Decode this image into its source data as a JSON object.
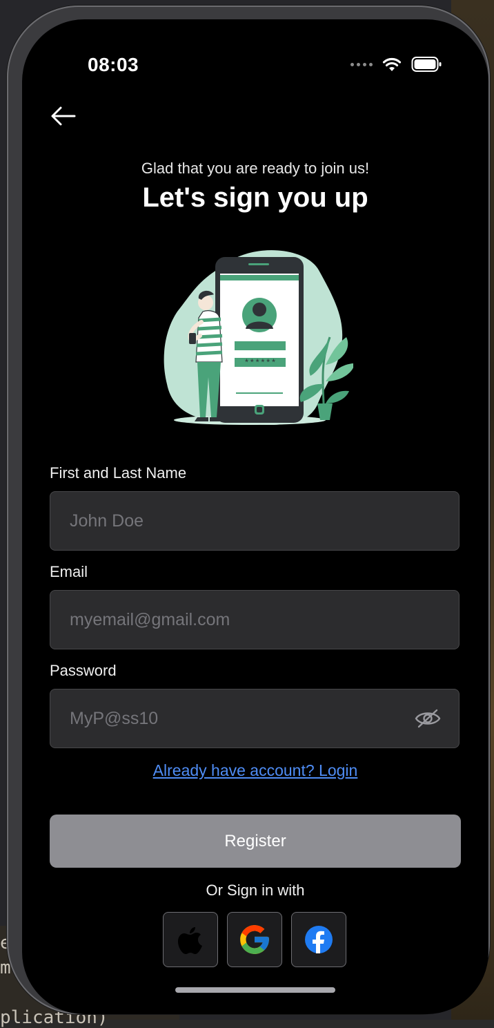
{
  "status_bar": {
    "time": "08:03"
  },
  "header": {
    "subtitle": "Glad that you are ready to join us!",
    "title": "Let's sign you up",
    "illustration_code": "******"
  },
  "form": {
    "name_label": "First and Last Name",
    "name_placeholder": "John Doe",
    "email_label": "Email",
    "email_placeholder": "myemail@gmail.com",
    "password_label": "Password",
    "password_placeholder": "MyP@ss10"
  },
  "login_link": "Already have account? Login",
  "register_label": "Register",
  "social": {
    "label": "Or Sign in with",
    "providers": [
      "apple-icon",
      "google-icon",
      "facebook-icon"
    ]
  },
  "colors": {
    "accent_green": "#4aa37a",
    "link_blue": "#4f8df5",
    "button_gray": "#8e8e93",
    "field_bg": "#2c2c2e"
  },
  "backdrop_text": [
    "e",
    "ml",
    "plication)"
  ]
}
